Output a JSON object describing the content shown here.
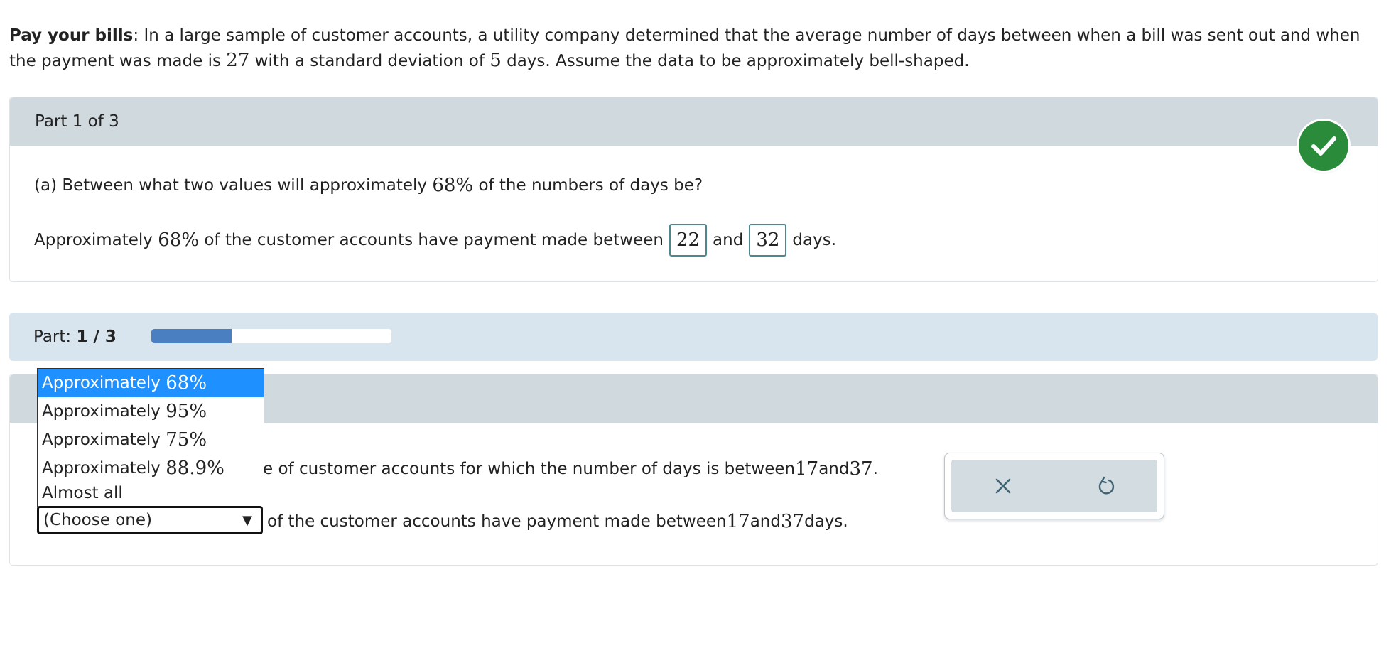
{
  "intro": {
    "bold": "Pay your bills",
    "text1": ": In a large sample of customer accounts, a utility company determined that the average number of days between when a bill was sent out and when the payment was made is ",
    "mean": "27",
    "text2": " with a standard deviation of ",
    "sd": "5",
    "text3": " days. Assume the data to be approximately bell-shaped."
  },
  "part1": {
    "header": "Part 1 of 3",
    "question_a": "(a) Between what two values will approximately ",
    "question_pct": "68%",
    "question_b": " of the numbers of days be?",
    "answer_a": "Approximately ",
    "answer_pct": "68%",
    "answer_b": " of the customer accounts have payment made between",
    "low": "22",
    "and": "and",
    "high": "32",
    "days": "days."
  },
  "progress": {
    "label": "Part:",
    "value_text": "1 / 3",
    "fraction": 0.333
  },
  "part2": {
    "question_visible": "e of customer accounts for which the number of days is between ",
    "q_low": "17",
    "q_and": " and ",
    "q_high": "37",
    "q_end": ".",
    "select_value": "(Choose one)",
    "answer_b": " of the customer accounts have payment made between ",
    "a_low": "17",
    "a_and": " and ",
    "a_high": "37",
    "a_end": " days."
  },
  "dropdown": {
    "options": [
      {
        "prefix": "Approximately ",
        "pct": "68%"
      },
      {
        "prefix": "Approximately ",
        "pct": "95%"
      },
      {
        "prefix": "Approximately ",
        "pct": "75%"
      },
      {
        "prefix": "Approximately ",
        "pct": "88.9%"
      },
      {
        "prefix": "Almost all",
        "pct": ""
      }
    ]
  },
  "tools": {
    "clear_icon": "x-icon",
    "undo_icon": "undo-icon"
  },
  "colors": {
    "correct": "#2a8b3a",
    "selected_option": "#1e90ff",
    "progress_fill": "#4a7fc1"
  }
}
